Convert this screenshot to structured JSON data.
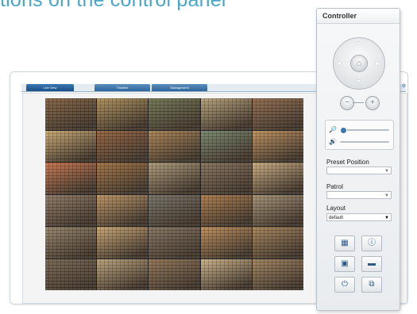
{
  "heading": "tions on the control panel",
  "viewer": {
    "tabs": [
      "Live View",
      "Timeline",
      "Management"
    ],
    "corner_icons": "5 ⚙"
  },
  "camera_tiles": [
    "#7b5a3a",
    "#a88a52",
    "#6a6f4a",
    "#b09a73",
    "#8a6446",
    "#c4a26a",
    "#8d5a36",
    "#a57c4c",
    "#6f7f64",
    "#b88955",
    "#c06c44",
    "#9b6b3a",
    "#a89473",
    "#7f6a54",
    "#c5a67a",
    "#87705b",
    "#b58d5c",
    "#6e6a5e",
    "#a67444",
    "#9f8b6e",
    "#8e7b61",
    "#c39f6b",
    "#7d6c58",
    "#b88652",
    "#a07d52",
    "#6f5d48",
    "#b49a72",
    "#8a6c4d",
    "#c6ab82",
    "#9a7b57"
  ],
  "controller": {
    "title": "Controller",
    "ptz_icons": [
      "arrow-up-icon",
      "arrow-down-icon",
      "arrow-left-icon",
      "arrow-right-icon",
      "home-icon"
    ],
    "zoom_out_symbol": "−",
    "zoom_in_symbol": "+",
    "zoom_symbol": "🔎",
    "volume_symbol": "🔊",
    "preset_label": "Preset Position",
    "preset_value": "",
    "patrol_label": "Patrol",
    "patrol_value": "",
    "layout_label": "Layout",
    "layout_value": "default",
    "dropdown_symbol": "▼"
  },
  "colors": {
    "accent": "#3a76b2",
    "heading": "#4aa7c9"
  }
}
